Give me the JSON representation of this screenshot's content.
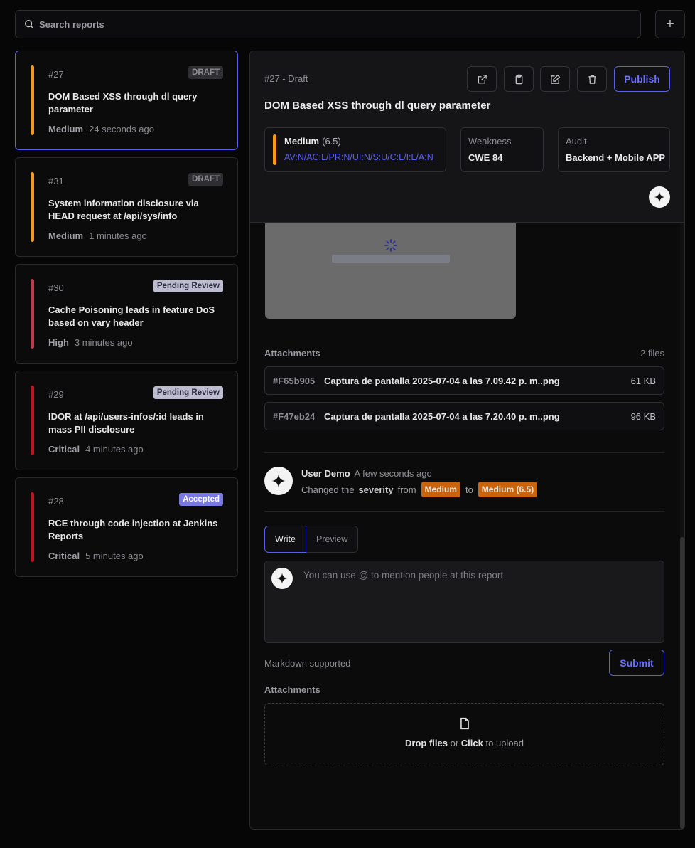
{
  "search": {
    "placeholder": "Search reports"
  },
  "add_button": {
    "icon": "plus-icon",
    "label": "+"
  },
  "reports": [
    {
      "id": "#27",
      "badge": "DRAFT",
      "badge_type": "draft",
      "title": "DOM Based XSS through dl query parameter",
      "severity": "Medium",
      "time": "24 seconds ago",
      "color": "#f59a1b",
      "selected": true
    },
    {
      "id": "#31",
      "badge": "DRAFT",
      "badge_type": "draft",
      "title": "System information disclosure via HEAD request at /api/sys/info",
      "severity": "Medium",
      "time": "1 minutes ago",
      "color": "#f59a1b",
      "selected": false
    },
    {
      "id": "#30",
      "badge": "Pending Review",
      "badge_type": "pending",
      "title": "Cache Poisoning leads in feature DoS based on vary header",
      "severity": "High",
      "time": "3 minutes ago",
      "color": "#c03a4e",
      "selected": false
    },
    {
      "id": "#29",
      "badge": "Pending Review",
      "badge_type": "pending",
      "title": "IDOR at /api/users-infos/:id leads in mass PII disclosure",
      "severity": "Critical",
      "time": "4 minutes ago",
      "color": "#c0121f",
      "selected": false
    },
    {
      "id": "#28",
      "badge": "Accepted",
      "badge_type": "accepted",
      "title": "RCE through code injection at Jenkins Reports",
      "severity": "Critical",
      "time": "5 minutes ago",
      "color": "#c0121f",
      "selected": false
    }
  ],
  "detail": {
    "id_status": "#27 - Draft",
    "title": "DOM Based XSS through dl query parameter",
    "publish_label": "Publish",
    "toolbar_icons": [
      "external-link-icon",
      "clipboard-icon",
      "edit-icon",
      "trash-icon"
    ],
    "severity": {
      "label": "Medium",
      "score": "(6.5)",
      "vector": "AV:N/AC:L/PR:N/UI:N/S:U/C:L/I:L/A:N",
      "color": "#f59a1b"
    },
    "weakness": {
      "label": "Weakness",
      "value": "CWE 84"
    },
    "audit": {
      "label": "Audit",
      "value": "Backend + Mobile APP"
    },
    "attachments": {
      "heading": "Attachments",
      "count": "2 files",
      "files": [
        {
          "hash": "#F65b905",
          "name": "Captura de pantalla 2025-07-04 a las 7.09.42 p. m..png",
          "size": "61 KB"
        },
        {
          "hash": "#F47eb24",
          "name": "Captura de pantalla 2025-07-04 a las 7.20.40 p. m..png",
          "size": "96 KB"
        }
      ]
    },
    "activity": {
      "user": "User Demo",
      "time": "A few seconds ago",
      "text_before": "Changed the",
      "field": "severity",
      "from_word": "from",
      "from_value": "Medium",
      "to_word": "to",
      "to_value": "Medium (6.5)"
    },
    "editor": {
      "tabs": [
        "Write",
        "Preview"
      ],
      "placeholder": "You can use @ to mention people at this report",
      "markdown_note": "Markdown supported",
      "submit_label": "Submit"
    },
    "upload": {
      "heading": "Attachments",
      "drop_label": "Drop files",
      "or_word": "or",
      "click_label": "Click",
      "suffix": "to upload"
    }
  }
}
